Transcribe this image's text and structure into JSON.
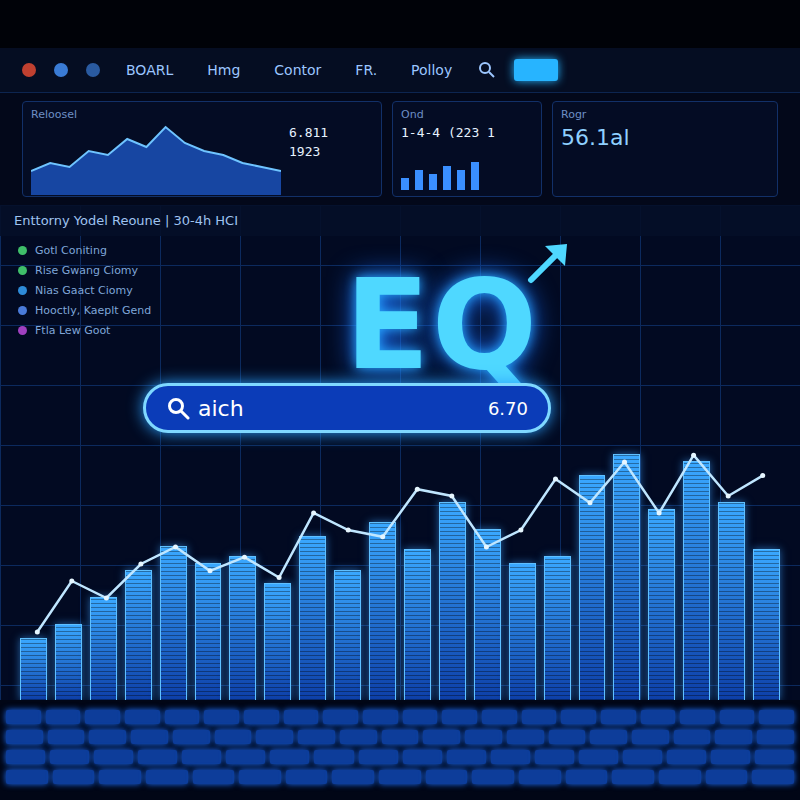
{
  "tabs": [
    {
      "label": "BOARL",
      "selected": false
    },
    {
      "label": "Hmg",
      "selected": false
    },
    {
      "label": "Contor",
      "selected": false
    },
    {
      "label": "FR.",
      "selected": false
    },
    {
      "label": "Polloy",
      "selected": false
    }
  ],
  "panels": {
    "left": {
      "label": "Reloosel",
      "readings": [
        "6.811",
        "1923"
      ],
      "series": [
        30,
        40,
        35,
        55,
        50,
        70,
        60,
        85,
        65,
        55,
        50,
        40,
        35,
        30
      ]
    },
    "middle": {
      "label": "Ond",
      "reading": "1-4-4 (223 1",
      "series": [
        3,
        5,
        4,
        6,
        5,
        7
      ]
    },
    "right": {
      "label": "Rogr",
      "reading": "56.1al"
    }
  },
  "subtitle": "Enttorny Yodel Reoune | 30-4h HCI",
  "sidebar": {
    "items": [
      {
        "label": "Gotl  Coniting",
        "color": "#3fbf6a"
      },
      {
        "label": "Rise  Gwang Ciomy",
        "color": "#3fbf6a"
      },
      {
        "label": "Nias  Gaact Ciomy",
        "color": "#2e8bd8"
      },
      {
        "label": "Hooctly, Kaeplt Gend",
        "color": "#4a7bd8"
      },
      {
        "label": "Ftla  Lew Goot",
        "color": "#a040c0"
      }
    ]
  },
  "logo": "EQ",
  "search": {
    "value": "aich",
    "reading": "6.70"
  },
  "chart": {
    "bars": [
      18,
      22,
      30,
      38,
      45,
      40,
      42,
      34,
      48,
      38,
      52,
      44,
      58,
      50,
      40,
      42,
      66,
      72,
      56,
      70,
      58,
      44
    ],
    "line": [
      20,
      35,
      30,
      40,
      45,
      38,
      42,
      36,
      55,
      50,
      48,
      62,
      60,
      45,
      50,
      65,
      58,
      70,
      55,
      72,
      60,
      66
    ]
  }
}
